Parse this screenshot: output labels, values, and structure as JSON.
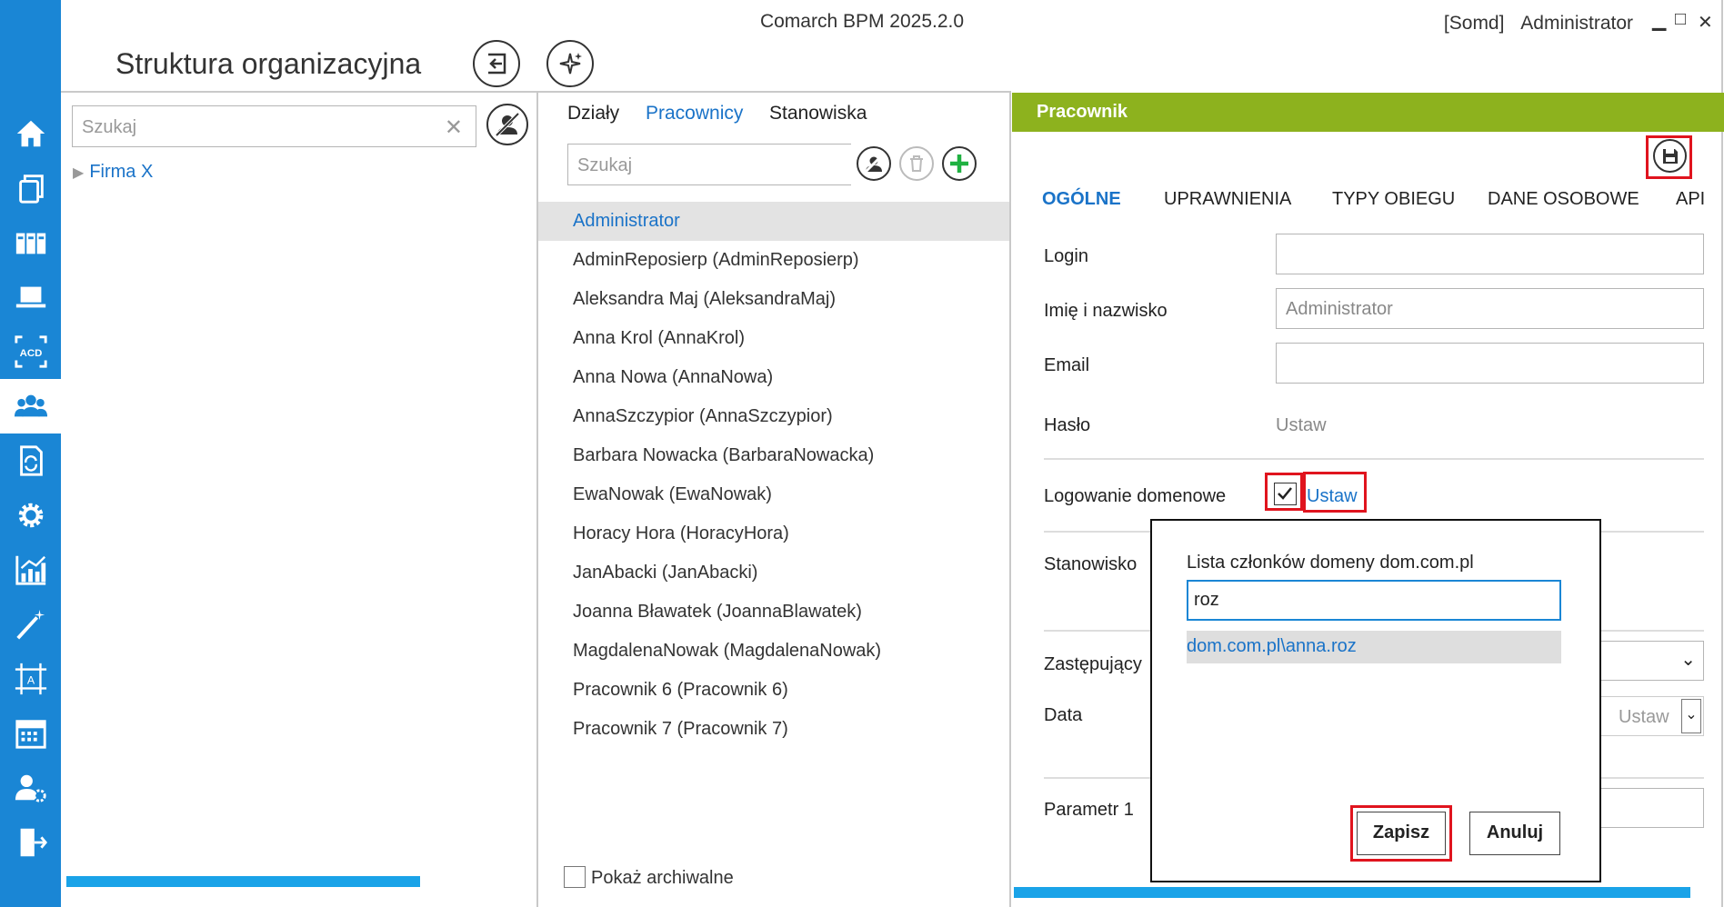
{
  "app": {
    "title": "Comarch BPM 2025.2.0",
    "company": "[Somd]",
    "user": "Administrator",
    "minimize": "▁",
    "maximize": "□",
    "close": "✕"
  },
  "page": {
    "title": "Struktura organizacyjna"
  },
  "rail": {
    "items": [
      "home-icon",
      "documents-icon",
      "library-icon",
      "laptop-icon",
      "ocr-icon",
      "users-icon",
      "workflow-icon",
      "gear-icon",
      "chart-icon",
      "wand-icon",
      "template-icon",
      "calendar-icon",
      "user-settings-icon",
      "logout-icon"
    ],
    "active_index": 5
  },
  "left_panel": {
    "search_placeholder": "Szukaj",
    "search_clear": "✕",
    "tree_toggle": "▶",
    "tree_root": "Firma X",
    "progress": 1.0
  },
  "middle_panel": {
    "tabs": [
      "Działy",
      "Pracownicy",
      "Stanowiska"
    ],
    "active_tab": 1,
    "search_placeholder": "Szukaj",
    "employees": [
      "Administrator",
      "AdminReposierp (AdminReposierp)",
      "Aleksandra Maj (AleksandraMaj)",
      "Anna Krol (AnnaKrol)",
      "Anna Nowa (AnnaNowa)",
      "AnnaSzczypior (AnnaSzczypior)",
      "Barbara Nowacka (BarbaraNowacka)",
      "EwaNowak (EwaNowak)",
      "Horacy Hora (HoracyHora)",
      "JanAbacki (JanAbacki)",
      "Joanna Bławatek (JoannaBlawatek)",
      "MagdalenaNowak (MagdalenaNowak)",
      "Pracownik 6 (Pracownik 6)",
      "Pracownik 7 (Pracownik 7)"
    ],
    "selected_index": 0,
    "archive_label": "Pokaż archiwalne"
  },
  "right_panel": {
    "header": "Pracownik",
    "tabs": [
      "OGÓLNE",
      "UPRAWNIENIA",
      "TYPY OBIEGU",
      "DANE OSOBOWE",
      "API"
    ],
    "active_tab": 0,
    "fields": {
      "login_label": "Login",
      "login_value": "",
      "name_label": "Imię i nazwisko",
      "name_value": "Administrator",
      "email_label": "Email",
      "email_value": "",
      "password_label": "Hasło",
      "password_action": "Ustaw",
      "domain_login_label": "Logowanie domenowe",
      "domain_login_checked": true,
      "domain_login_action": "Ustaw",
      "position_label": "Stanowisko",
      "substitute_label": "Zastępujący",
      "date_label": "Data",
      "date_action": "Ustaw",
      "param1_label": "Parametr 1"
    }
  },
  "modal": {
    "title_prefix": "Lista członków domeny",
    "domain": "dom.com.pl",
    "search_value": "roz",
    "results": [
      "dom.com.pl\\anna.roz"
    ],
    "save_label": "Zapisz",
    "cancel_label": "Anuluj"
  }
}
